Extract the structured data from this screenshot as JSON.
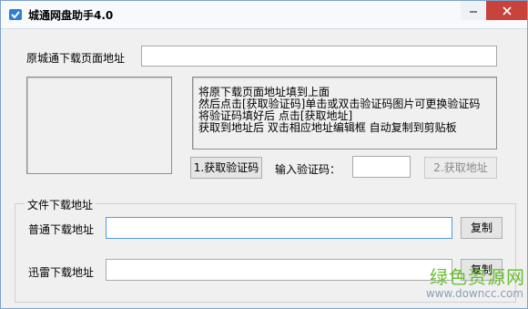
{
  "window": {
    "title": "城通网盘助手4.0"
  },
  "top": {
    "page_url_label": "原城通下载页面地址",
    "page_url_value": ""
  },
  "help": {
    "lines": [
      "将原下载页面地址填到上面",
      "然后点击[获取验证码]单击或双击验证码图片可更换验证码",
      "将验证码填好后 点击[获取地址]",
      "获取到地址后 双击相应地址编辑框 自动复制到剪贴板"
    ]
  },
  "actions": {
    "get_captcha_label": "1.获取验证码",
    "captcha_input_label": "输入验证码：",
    "captcha_value": "",
    "get_address_label": "2.获取地址"
  },
  "download_group": {
    "title": "文件下载地址",
    "normal_label": "普通下载地址",
    "normal_value": "",
    "thunder_label": "迅雷下载地址",
    "thunder_value": "",
    "copy_label": "复制"
  },
  "watermark": {
    "cn": "绿色资源网",
    "url": "www.downcc.com"
  },
  "colors": {
    "close_button": "#c7433c",
    "watermark_green": "#6abf33",
    "focus_border": "#4f9ade"
  }
}
